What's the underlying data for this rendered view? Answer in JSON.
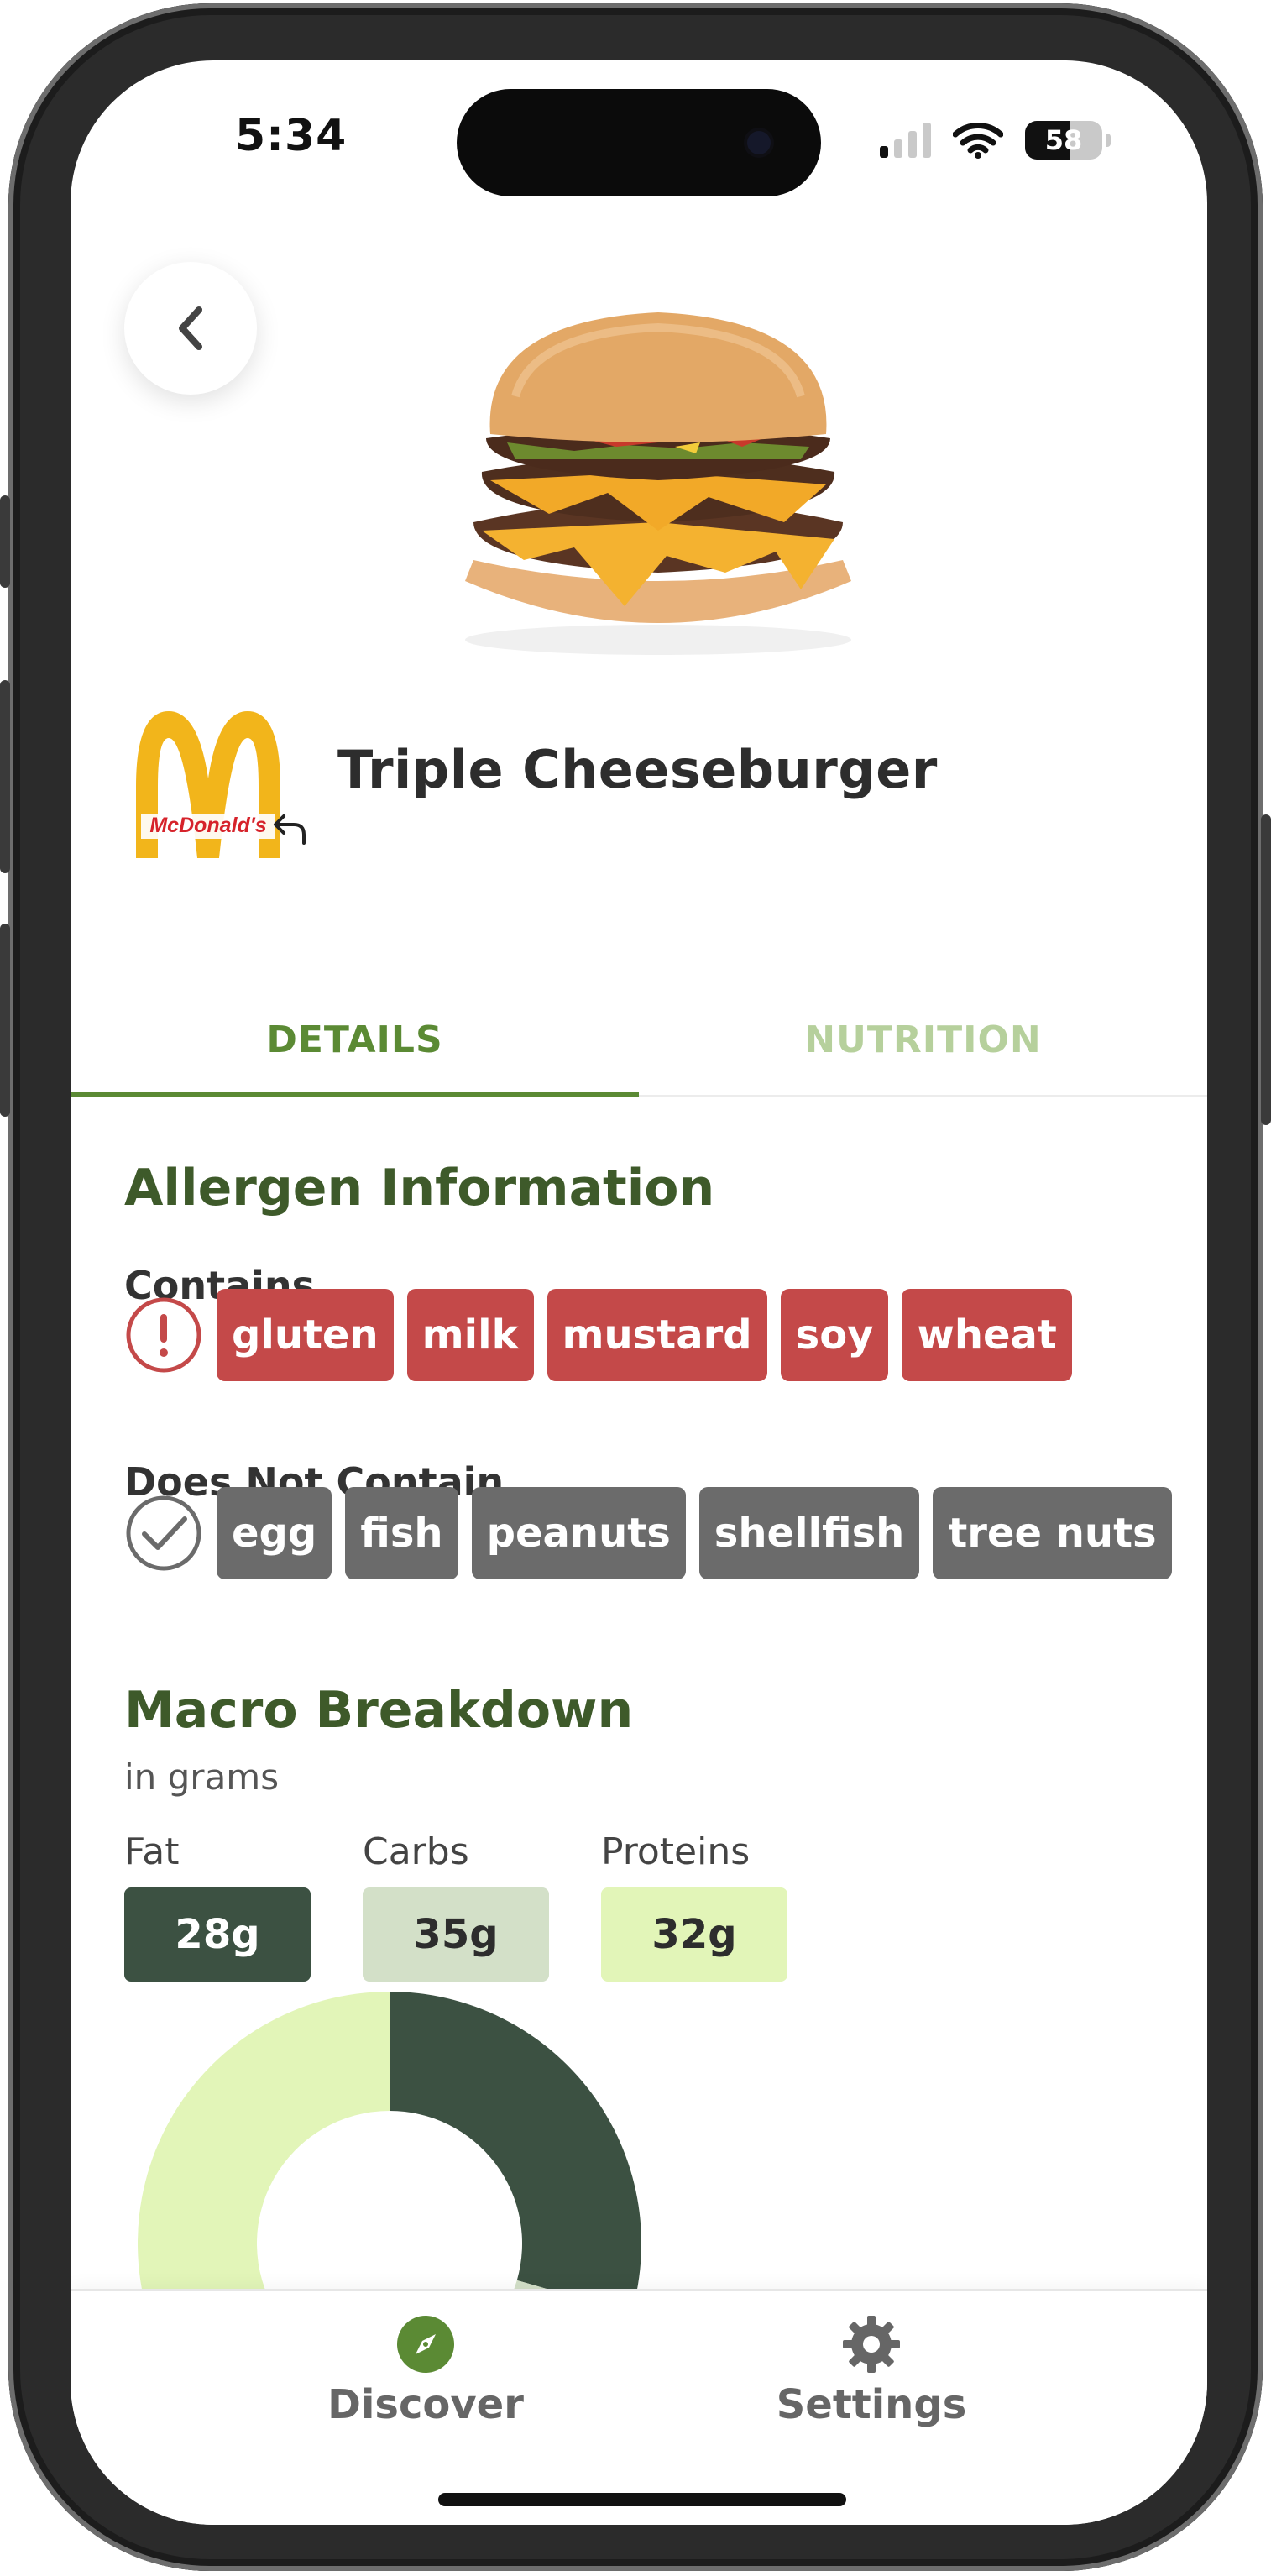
{
  "status_bar": {
    "time": "5:34",
    "battery": "58",
    "battery_level": 0.58
  },
  "icons": {
    "back": "chevron-left-icon",
    "undo": "undo-arrow-icon",
    "contains": "exclamation-circle-icon",
    "not_contains": "check-circle-icon",
    "discover": "compass-icon",
    "settings": "gear-icon"
  },
  "header": {
    "brand_logo_text": "McDonald's",
    "item_name": "Triple Cheeseburger"
  },
  "tabs": [
    {
      "label": "DETAILS",
      "active": true
    },
    {
      "label": "NUTRITION",
      "active": false
    }
  ],
  "allergens": {
    "title": "Allergen Information",
    "contains_label": "Contains",
    "contains": [
      "gluten",
      "milk",
      "mustard",
      "soy",
      "wheat"
    ],
    "not_contains_label": "Does Not Contain",
    "not_contains": [
      "egg",
      "fish",
      "peanuts",
      "shellfish",
      "tree nuts"
    ]
  },
  "macros": {
    "title": "Macro Breakdown",
    "subtitle": "in grams",
    "items": [
      {
        "label": "Fat",
        "value": "28g",
        "color": "#3c5142",
        "text_color": "#ffffff"
      },
      {
        "label": "Carbs",
        "value": "35g",
        "color": "#d3e0c8",
        "text_color": "#2d2d2d"
      },
      {
        "label": "Proteins",
        "value": "32g",
        "color": "#e2f5b8",
        "text_color": "#2d2d2d"
      }
    ]
  },
  "chart_data": {
    "type": "pie",
    "categories": [
      "Fat",
      "Carbs",
      "Proteins"
    ],
    "values": [
      28,
      35,
      32
    ],
    "colors": [
      "#3c5142",
      "#d3e0c8",
      "#e2f5b8"
    ]
  },
  "bottom_nav": [
    {
      "label": "Discover",
      "icon": "compass-icon",
      "color": "#5b8a34"
    },
    {
      "label": "Settings",
      "icon": "gear-icon",
      "color": "#666666"
    }
  ],
  "colors": {
    "accent": "#5b8a34",
    "heading": "#3e5a2a",
    "allergen_red": "#c44949",
    "neutral_gray": "#6b6b6b"
  }
}
